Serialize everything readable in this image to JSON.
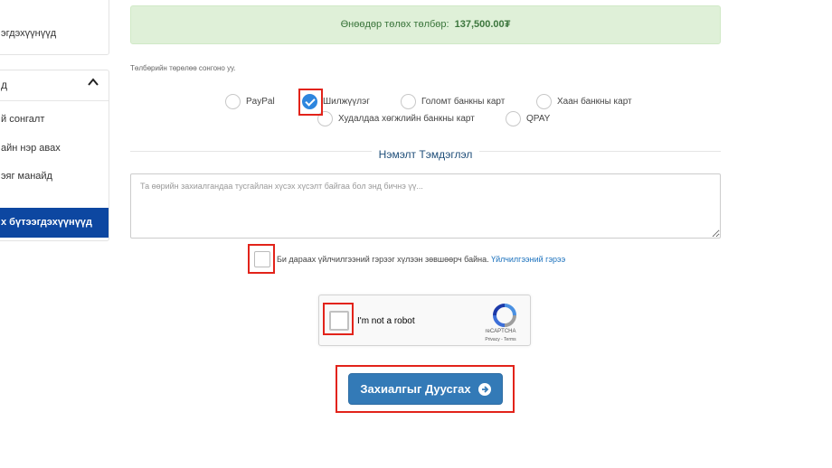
{
  "sidebar": {
    "top_item": "эгдэхүүнүүд",
    "section_title": "д",
    "links": [
      "й сонгалт",
      "айн нэр авах",
      "эяг манайд"
    ],
    "active_item": "х бүтээгдэхүүнүүд"
  },
  "amount": {
    "label": "Өнөөдөр төлөх төлбөр:",
    "value": "137,500.00₮"
  },
  "payment": {
    "hint": "Төлбөрийн төрөлөө сонгоно уу.",
    "options": [
      {
        "label": "PayPal",
        "checked": false
      },
      {
        "label": "Шилжүүлэг",
        "checked": true
      },
      {
        "label": "Голомт банкны карт",
        "checked": false
      },
      {
        "label": "Хаан банкны карт",
        "checked": false
      },
      {
        "label": "Худалдаа хөгжлийн банкны карт",
        "checked": false
      },
      {
        "label": "QPAY",
        "checked": false
      }
    ]
  },
  "note": {
    "title": "Нэмэлт Тэмдэглэл",
    "placeholder": "Та өөрийн захиалгандаа тусгайлан хүсэх хүсэлт байгаа бол энд бичнэ үү..."
  },
  "agreement": {
    "text": "Би дараах үйлчилгээний гэрээг хүлээн зөвшөөрч байна.",
    "link": "Үйлчилгээний гэрээ",
    "checked": false
  },
  "recaptcha": {
    "label": "I'm not a robot",
    "brand": "reCAPTCHA",
    "terms": "Privacy - Terms"
  },
  "submit": {
    "label": "Захиалгыг Дуусгах"
  },
  "colors": {
    "accent": "#337ab7",
    "highlight": "#e2231a",
    "sidebar_active": "#0d47a1",
    "success_bg": "#dff0d8"
  }
}
